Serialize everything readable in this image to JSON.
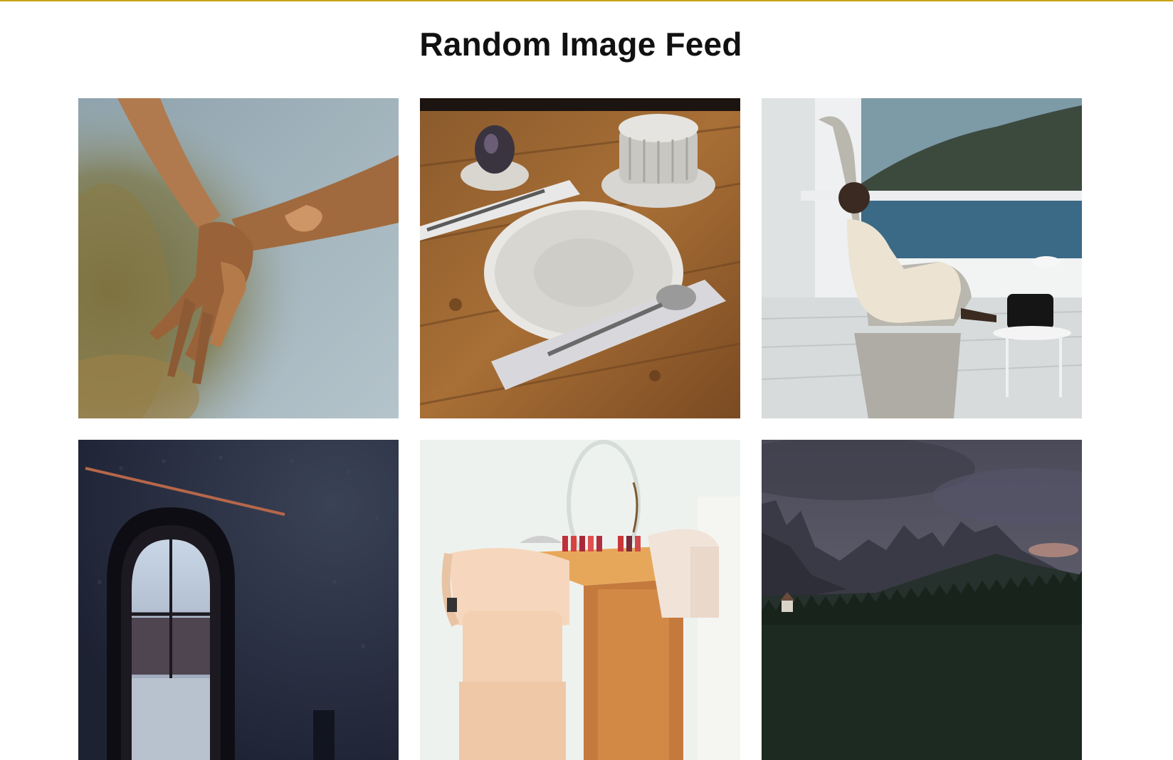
{
  "page": {
    "title": "Random Image Feed",
    "accent_color": "#c8a415"
  },
  "feed": {
    "images": [
      {
        "subject": "two hands clasped against a pale sky"
      },
      {
        "subject": "ceramic plate, cup and cutlery on a wooden table"
      },
      {
        "subject": "woman in a wicker chair on a seaside terrace"
      },
      {
        "subject": "arched window in a dark patterned room"
      },
      {
        "subject": "manicure desk with round mirror and chairs"
      },
      {
        "subject": "jagged mountains under a dark cloudy sky"
      }
    ]
  }
}
